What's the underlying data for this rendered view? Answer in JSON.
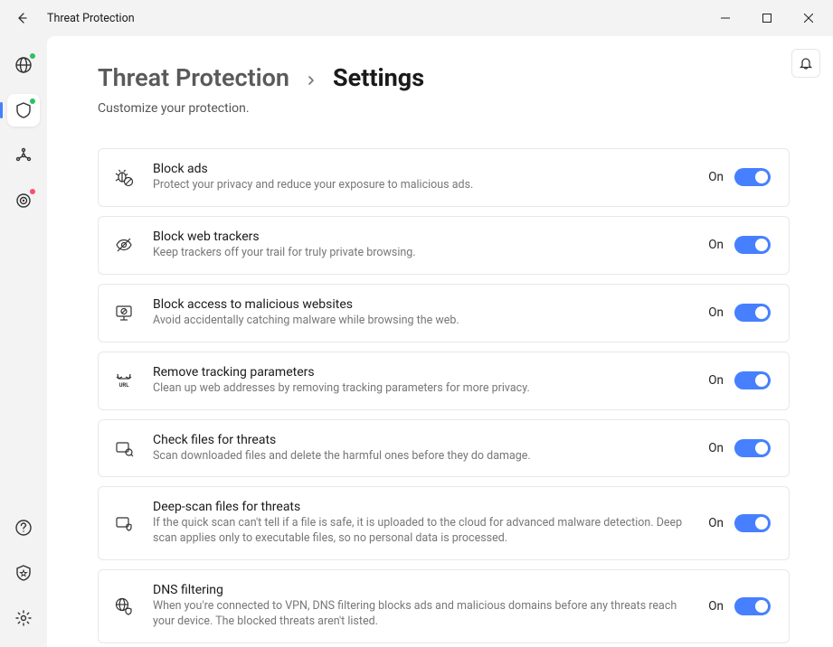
{
  "window": {
    "title": "Threat Protection"
  },
  "breadcrumb": {
    "parent": "Threat Protection",
    "current": "Settings"
  },
  "subtitle": "Customize your protection.",
  "settings": [
    {
      "icon": "bug-block",
      "title": "Block ads",
      "desc": "Protect your privacy and reduce your exposure to malicious ads.",
      "state_label": "On",
      "state": true
    },
    {
      "icon": "eye-off",
      "title": "Block web trackers",
      "desc": "Keep trackers off your trail for truly private browsing.",
      "state_label": "On",
      "state": true
    },
    {
      "icon": "monitor-block",
      "title": "Block access to malicious websites",
      "desc": "Avoid accidentally catching malware while browsing the web.",
      "state_label": "On",
      "state": true
    },
    {
      "icon": "url-clean",
      "title": "Remove tracking parameters",
      "desc": "Clean up web addresses by removing tracking parameters for more privacy.",
      "state_label": "On",
      "state": true
    },
    {
      "icon": "file-scan",
      "title": "Check files for threats",
      "desc": "Scan downloaded files and delete the harmful ones before they do damage.",
      "state_label": "On",
      "state": true
    },
    {
      "icon": "file-deep-scan",
      "title": "Deep-scan files for threats",
      "desc": "If the quick scan can't tell if a file is safe, it is uploaded to the cloud for advanced malware detection. Deep scan applies only to executable files, so no personal data is processed.",
      "state_label": "On",
      "state": true
    },
    {
      "icon": "dns-filter",
      "title": "DNS filtering",
      "desc": "When you're connected to VPN, DNS filtering blocks ads and malicious domains before any threats reach your device. The blocked threats aren't listed.",
      "state_label": "On",
      "state": true
    }
  ],
  "sidebar": {
    "items": [
      {
        "name": "globe",
        "badge_color": "#2ec060"
      },
      {
        "name": "shield",
        "active": true,
        "badge_color": "#2ec060"
      },
      {
        "name": "mesh"
      },
      {
        "name": "target",
        "badge_color": "#ff4d6d"
      }
    ],
    "bottom_items": [
      {
        "name": "help"
      },
      {
        "name": "shield-star"
      },
      {
        "name": "gear"
      }
    ]
  }
}
